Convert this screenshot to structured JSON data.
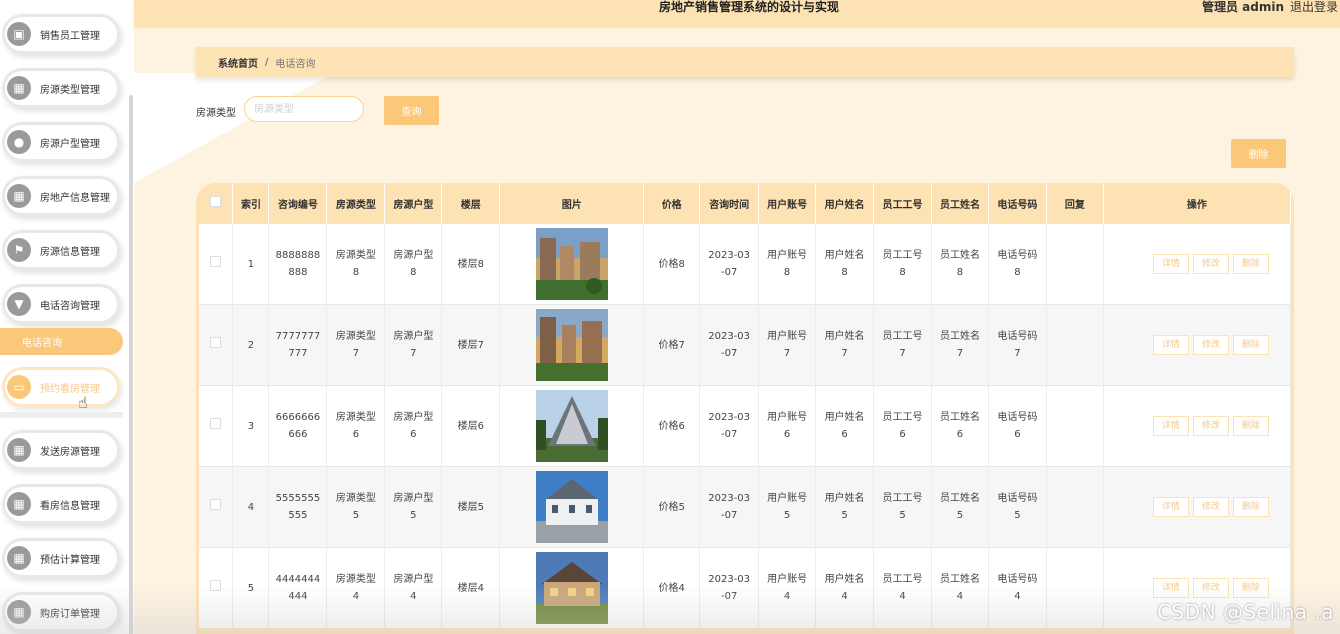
{
  "header": {
    "title": "房地产销售管理系统的设计与实现",
    "admin": "管理员 admin",
    "logout": "退出登录"
  },
  "sidebar": {
    "items": [
      {
        "label": "销售员工管理",
        "icon": "user-card-icon"
      },
      {
        "label": "房源类型管理",
        "icon": "grid-icon"
      },
      {
        "label": "房源户型管理",
        "icon": "bulb-icon"
      },
      {
        "label": "房地产信息管理",
        "icon": "grid-icon"
      },
      {
        "label": "房源信息管理",
        "icon": "flag-icon"
      },
      {
        "label": "电话咨询管理",
        "icon": "cup-icon"
      },
      {
        "label": "预约看房管理",
        "icon": "monitor-icon"
      },
      {
        "label": "发送房源管理",
        "icon": "grid-icon"
      },
      {
        "label": "看房信息管理",
        "icon": "grid-icon"
      },
      {
        "label": "预估计算管理",
        "icon": "grid-icon"
      },
      {
        "label": "购房订单管理",
        "icon": "grid-icon"
      }
    ],
    "submenu": "电话咨询"
  },
  "breadcrumb": {
    "home": "系统首页",
    "sep": "/",
    "current": "电话咨询"
  },
  "search": {
    "label": "房源类型",
    "placeholder": "房源类型",
    "button": "查询"
  },
  "toolbar": {
    "delete": "删除"
  },
  "table": {
    "headers": [
      "索引",
      "咨询编号",
      "房源类型",
      "房源户型",
      "楼层",
      "图片",
      "价格",
      "咨询时间",
      "用户账号",
      "用户姓名",
      "员工工号",
      "员工姓名",
      "电话号码",
      "回复",
      "操作"
    ],
    "rows": [
      {
        "index": "1",
        "code": "8888888\n888",
        "type": "房源类型\n8",
        "layout": "房源户型\n8",
        "floor": "楼层8",
        "price": "价格8",
        "time": "2023-03\n-07",
        "account": "用户账号\n8",
        "name": "用户姓名\n8",
        "empno": "员工工号\n8",
        "empname": "员工姓名\n8",
        "phone": "电话号码\n8",
        "reply": ""
      },
      {
        "index": "2",
        "code": "7777777\n777",
        "type": "房源类型\n7",
        "layout": "房源户型\n7",
        "floor": "楼层7",
        "price": "价格7",
        "time": "2023-03\n-07",
        "account": "用户账号\n7",
        "name": "用户姓名\n7",
        "empno": "员工工号\n7",
        "empname": "员工姓名\n7",
        "phone": "电话号码\n7",
        "reply": ""
      },
      {
        "index": "3",
        "code": "6666666\n666",
        "type": "房源类型\n6",
        "layout": "房源户型\n6",
        "floor": "楼层6",
        "price": "价格6",
        "time": "2023-03\n-07",
        "account": "用户账号\n6",
        "name": "用户姓名\n6",
        "empno": "员工工号\n6",
        "empname": "员工姓名\n6",
        "phone": "电话号码\n6",
        "reply": ""
      },
      {
        "index": "4",
        "code": "5555555\n555",
        "type": "房源类型\n5",
        "layout": "房源户型\n5",
        "floor": "楼层5",
        "price": "价格5",
        "time": "2023-03\n-07",
        "account": "用户账号\n5",
        "name": "用户姓名\n5",
        "empno": "员工工号\n5",
        "empname": "员工姓名\n5",
        "phone": "电话号码\n5",
        "reply": ""
      },
      {
        "index": "5",
        "code": "4444444\n444",
        "type": "房源类型\n4",
        "layout": "房源户型\n4",
        "floor": "楼层4",
        "price": "价格4",
        "time": "2023-03\n-07",
        "account": "用户账号\n4",
        "name": "用户姓名\n4",
        "empno": "员工工号\n4",
        "empname": "员工姓名\n4",
        "phone": "电话号码\n4",
        "reply": ""
      }
    ],
    "ops": {
      "detail": "详情",
      "edit": "修改",
      "delete": "删除"
    }
  },
  "watermark": "CSDN @Selina .a",
  "colors": {
    "accent": "#fbc779",
    "header_bg": "#fde2b4",
    "main_bg": "#fef3e1"
  }
}
